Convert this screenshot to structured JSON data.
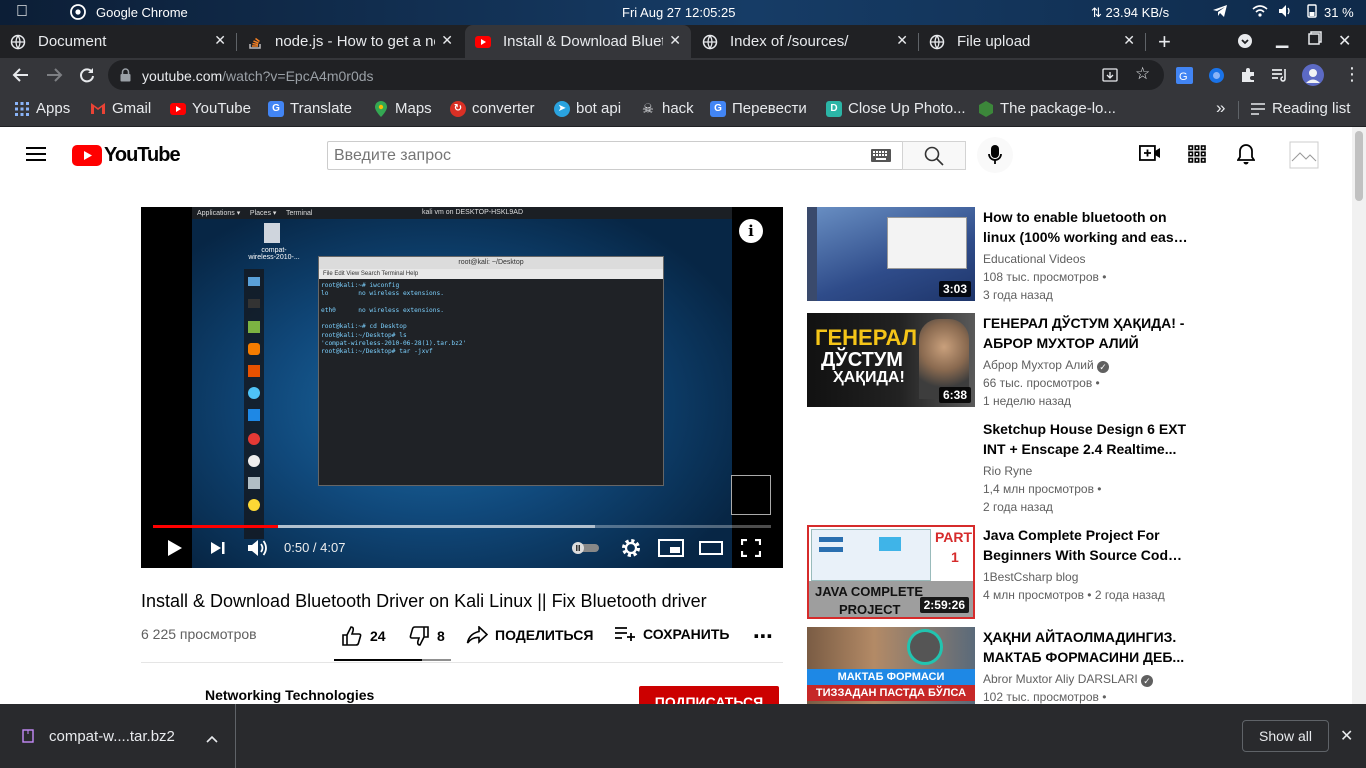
{
  "os_bar": {
    "app_name": "Google Chrome",
    "datetime": "Fri Aug 27  12:05:25",
    "net_speed": "⇅ 23.94 KB/s",
    "battery": "31 %"
  },
  "tabs": [
    {
      "title": "Document"
    },
    {
      "title": "node.js - How to get a nod"
    },
    {
      "title": "Install & Download Bluet"
    },
    {
      "title": "Index of /sources/"
    },
    {
      "title": "File upload"
    }
  ],
  "address_bar": {
    "host": "youtube.com",
    "path": "/watch?v=EpcA4m0r0ds"
  },
  "bookmarks": [
    {
      "label": "Apps"
    },
    {
      "label": "Gmail"
    },
    {
      "label": "YouTube"
    },
    {
      "label": "Translate"
    },
    {
      "label": "Maps"
    },
    {
      "label": "converter"
    },
    {
      "label": "bot api"
    },
    {
      "label": "hack"
    },
    {
      "label": "Перевести"
    },
    {
      "label": "Close Up Photo..."
    },
    {
      "label": "The package-lo..."
    }
  ],
  "reading_list": "Reading list",
  "youtube": {
    "logo_text": "YouTube",
    "search_placeholder": "Введите запрос"
  },
  "player": {
    "time": "0:50 / 4:07",
    "progress_fraction": 0.2024,
    "buffer_fraction": 0.715,
    "terminal_title": "root@kali: ~/Desktop",
    "terminal_menu": "File   Edit   View   Search   Terminal   Help",
    "terminal_text": "root@kali:~# iwconfig\nlo        no wireless extensions.\n\neth0      no wireless extensions.\n\nroot@kali:~# cd Desktop\nroot@kali:~/Desktop# ls\n'compat-wireless-2010-06-28(1).tar.bz2'\nroot@kali:~/Desktop# tar -jxvf",
    "desktop_icon_label": "compat-\nwireless-2010-...",
    "kali_menu": "Applications ▾     Places ▾     Terminal",
    "kali_center": "kali vm on DESKTOP-HSKL9AD"
  },
  "video": {
    "title": "Install & Download Bluetooth Driver on Kali Linux || Fix Bluetooth driver",
    "views": "6 225 просмотров",
    "likes": "24",
    "dislikes": "8",
    "like_fraction": 0.75,
    "share_label": "ПОДЕЛИТЬСЯ",
    "save_label": "СОХРАНИТЬ",
    "channel": "Networking Technologies",
    "subscribe_label": "ПОДПИСАТЬСЯ"
  },
  "recommendations": [
    {
      "title_line1": "How to enable bluetooth on",
      "title_line2": "linux (100% working and easy...",
      "channel": "Educational Videos",
      "views": "108 тыс. просмотров •",
      "age": "3 года назад",
      "duration": "3:03"
    },
    {
      "title_line1": "ГЕНЕРАЛ ДЎСТУМ ҲАҚИДА! -",
      "title_line2": "АБРОР МУХТОР АЛИЙ",
      "channel": "Аброр Мухтор Алий",
      "views": "66 тыс. просмотров •",
      "age": "1 неделю назад",
      "duration": "6:38",
      "thumb_text1": "ГЕНЕРАЛ",
      "thumb_text2": "ДЎСТУМ",
      "thumb_text3": "ҲАҚИДА!"
    },
    {
      "title_line1": "Sketchup House Design 6 EXT",
      "title_line2": "INT + Enscape 2.4 Realtime...",
      "channel": "Rio Ryne",
      "views": "1,4 млн просмотров •",
      "age": "2 года назад"
    },
    {
      "title_line1": "Java Complete Project For",
      "title_line2": "Beginners With Source Code ...",
      "channel": "1BestCsharp blog",
      "views": "4 млн просмотров • 2 года назад",
      "duration": "2:59:26",
      "thumb_text1": "JAVA COMPLETE",
      "thumb_text2": "PROJECT",
      "thumb_part": "PART",
      "thumb_part_no": "1"
    },
    {
      "title_line1": "ҲАҚНИ АЙТАОЛМАДИНГИЗ.",
      "title_line2": "МАКТАБ ФОРМАСИНИ ДЕБ...",
      "channel": "Abror Muxtor Aliy DARSLARI",
      "views": "102 тыс. просмотров •",
      "thumb_text1": "МАКТАБ ФОРМАСИ",
      "thumb_text2": "ТИЗЗАДАН ПАСТДА БЎЛСА"
    }
  ],
  "download": {
    "filename": "compat-w....tar.bz2",
    "show_all": "Show all"
  },
  "colors": {
    "youtube_red": "#ff0000",
    "subscribe_red": "#cc0000",
    "chrome_dark": "#202124",
    "chrome_toolbar": "#35363a"
  }
}
